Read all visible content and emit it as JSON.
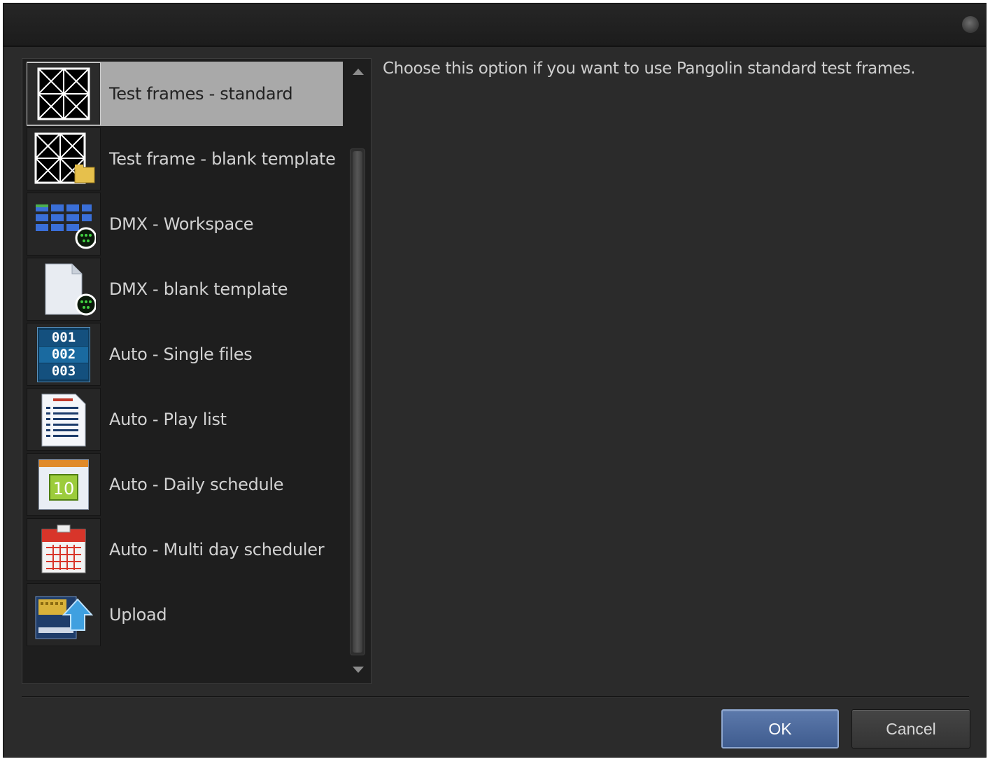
{
  "description": "Choose this option if you want to use Pangolin standard test frames.",
  "items": [
    {
      "label": "Test frames - standard",
      "icon": "test-frame-grid-icon",
      "selected": true
    },
    {
      "label": "Test frame - blank template",
      "icon": "test-frame-folder-icon",
      "selected": false
    },
    {
      "label": "DMX - Workspace",
      "icon": "dmx-grid-icon",
      "selected": false
    },
    {
      "label": "DMX - blank template",
      "icon": "dmx-document-icon",
      "selected": false
    },
    {
      "label": "Auto - Single files",
      "icon": "numbered-list-icon",
      "selected": false
    },
    {
      "label": "Auto - Play list",
      "icon": "playlist-document-icon",
      "selected": false
    },
    {
      "label": "Auto - Daily schedule",
      "icon": "daily-calendar-icon",
      "selected": false
    },
    {
      "label": "Auto - Multi day scheduler",
      "icon": "multi-day-calendar-icon",
      "selected": false
    },
    {
      "label": "Upload",
      "icon": "upload-icon",
      "selected": false
    }
  ],
  "icon_text": {
    "numbers": [
      "001",
      "002",
      "003"
    ],
    "calendar_day": "10"
  },
  "buttons": {
    "ok": "OK",
    "cancel": "Cancel"
  },
  "colors": {
    "selected_bg": "#a9a9a9",
    "ok_button": "#4a6799",
    "panel_bg": "#1e1e1e",
    "window_bg": "#2b2b2b"
  }
}
